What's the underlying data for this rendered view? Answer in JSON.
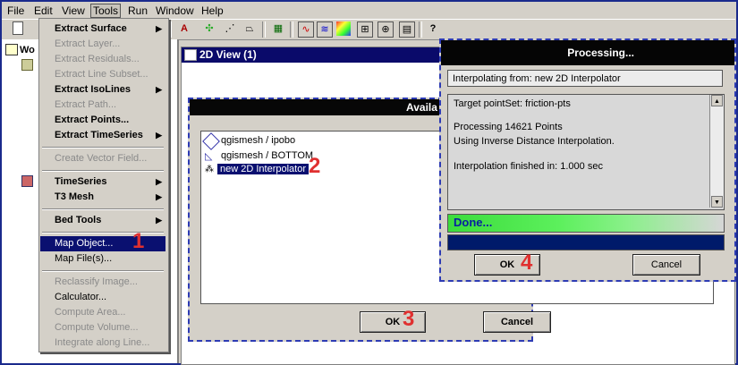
{
  "menubar": [
    "File",
    "Edit",
    "View",
    "Tools",
    "Run",
    "Window",
    "Help"
  ],
  "tree": {
    "root": "Wo"
  },
  "view2d": {
    "title": "2D View (1)"
  },
  "tools_menu": [
    {
      "label": "Extract Surface",
      "state": "on",
      "submenu": true
    },
    {
      "label": "Extract Layer...",
      "state": "off"
    },
    {
      "label": "Extract Residuals...",
      "state": "off"
    },
    {
      "label": "Extract Line Subset...",
      "state": "off"
    },
    {
      "label": "Extract IsoLines",
      "state": "on",
      "submenu": true
    },
    {
      "label": "Extract Path...",
      "state": "off"
    },
    {
      "label": "Extract Points...",
      "state": "on"
    },
    {
      "label": "Extract TimeSeries",
      "state": "on",
      "submenu": true
    },
    {
      "label": "Create Vector Field...",
      "state": "off"
    },
    {
      "label": "TimeSeries",
      "state": "on",
      "submenu": true
    },
    {
      "label": "T3 Mesh",
      "state": "on",
      "submenu": true
    },
    {
      "label": "Bed Tools",
      "state": "on",
      "submenu": true
    },
    {
      "label": "Map Object...",
      "state": "sel"
    },
    {
      "label": "Map File(s)...",
      "state": "on"
    },
    {
      "label": "Reclassify Image...",
      "state": "off"
    },
    {
      "label": "Calculator...",
      "state": "on"
    },
    {
      "label": "Compute Area...",
      "state": "off"
    },
    {
      "label": "Compute Volume...",
      "state": "off"
    },
    {
      "label": "Integrate along Line...",
      "state": "off"
    }
  ],
  "available_dialog": {
    "title": "Availa",
    "items": [
      "qgismesh / ipobo",
      "qgismesh / BOTTOM",
      "new 2D Interpolator"
    ],
    "ok": "OK",
    "cancel": "Cancel"
  },
  "processing_dialog": {
    "title": "Processing...",
    "from": "Interpolating from: new 2D Interpolator",
    "log": [
      "Target pointSet: friction-pts",
      "",
      "Processing 14621 Points",
      "Using Inverse Distance Interpolation.",
      "",
      "Interpolation finished in: 1.000 sec"
    ],
    "status": "Done...",
    "ok": "OK",
    "cancel": "Cancel"
  },
  "steps": [
    "1",
    "2",
    "3",
    "4"
  ],
  "colors": {
    "menu_highlight": "#0a1070",
    "title_dark": "#0a0a6a",
    "progress": "#3cdc3c",
    "step_red": "#e03030"
  }
}
